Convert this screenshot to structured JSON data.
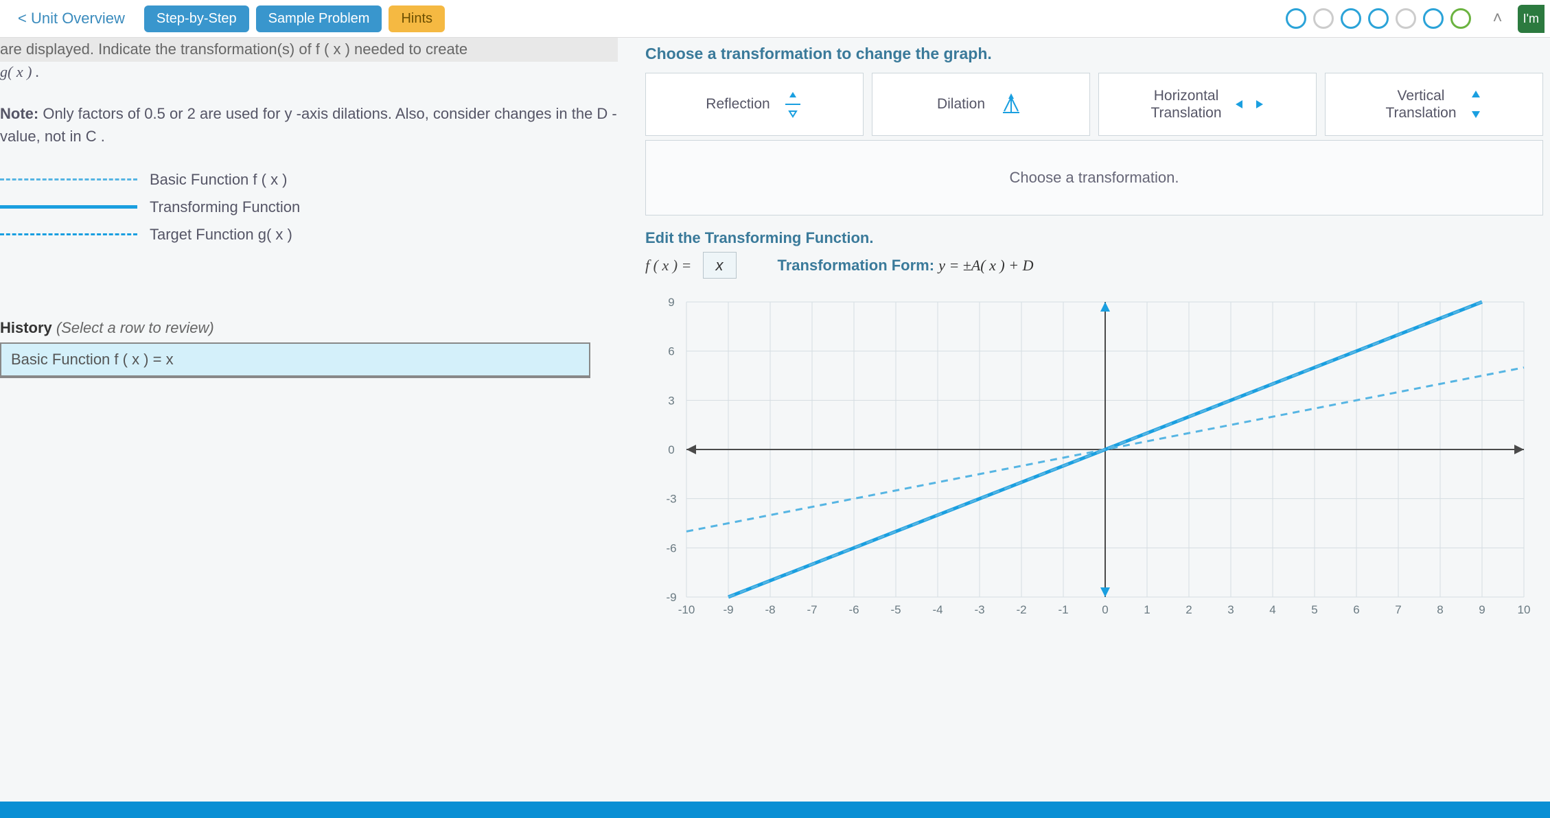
{
  "topbar": {
    "overview": "< Unit Overview",
    "step_by_step": "Step-by-Step",
    "sample_problem": "Sample Problem",
    "hints": "Hints",
    "im": "I'm"
  },
  "left": {
    "instr_cut": "are displayed. Indicate the transformation(s) of f ( x ) needed to create",
    "instr_gx": "g( x ) .",
    "note_html": "Note: Only factors of 0.5 or 2 are used for y -axis dilations. Also, consider changes in the D -value, not in C .",
    "note_label": "Note:",
    "note_text": " Only factors of 0.5 or 2 are used for y -axis dilations. Also, consider changes in the D -value, not in C .",
    "legend_basic": "Basic Function  f ( x )",
    "legend_transforming": "Transforming Function",
    "legend_target": "Target Function  g( x )",
    "history_label": "History",
    "history_hint": " (Select a row to review)",
    "history_row1": "Basic Function  f ( x ) = x"
  },
  "right": {
    "choose_head": "Choose a transformation to change the graph.",
    "btn_reflection": "Reflection",
    "btn_dilation": "Dilation",
    "btn_htrans_l1": "Horizontal",
    "btn_htrans_l2": "Translation",
    "btn_vtrans_l1": "Vertical",
    "btn_vtrans_l2": "Translation",
    "choose_strip": "Choose a transformation.",
    "edit_head": "Edit the Transforming Function.",
    "fx_label": "f ( x ) =",
    "fx_value": "x",
    "tform_label": "Transformation Form: ",
    "tform_math": "y = ±A( x ) + D"
  },
  "chart_data": {
    "type": "line",
    "title": "",
    "xlabel": "",
    "ylabel": "",
    "xlim": [
      -10,
      10
    ],
    "ylim": [
      -9,
      9
    ],
    "x_ticks": [
      -10,
      -9,
      -8,
      -7,
      -6,
      -5,
      -4,
      -3,
      -2,
      -1,
      0,
      1,
      2,
      3,
      4,
      5,
      6,
      7,
      8,
      9,
      10
    ],
    "y_ticks": [
      -9,
      -6,
      -3,
      0,
      3,
      6,
      9
    ],
    "series": [
      {
        "name": "Transforming Function (y = x)",
        "style": "solid",
        "color": "#1a9fe0",
        "points": [
          [
            -10,
            -10
          ],
          [
            10,
            10
          ]
        ]
      },
      {
        "name": "Basic Function f(x) = x",
        "style": "dashed",
        "color": "#56b5e3",
        "points": [
          [
            -10,
            -10
          ],
          [
            10,
            10
          ]
        ]
      },
      {
        "name": "Target Function g(x) = 0.5x",
        "style": "dashed",
        "color": "#56b5e3",
        "points": [
          [
            -10,
            -5
          ],
          [
            10,
            5
          ]
        ]
      }
    ]
  }
}
